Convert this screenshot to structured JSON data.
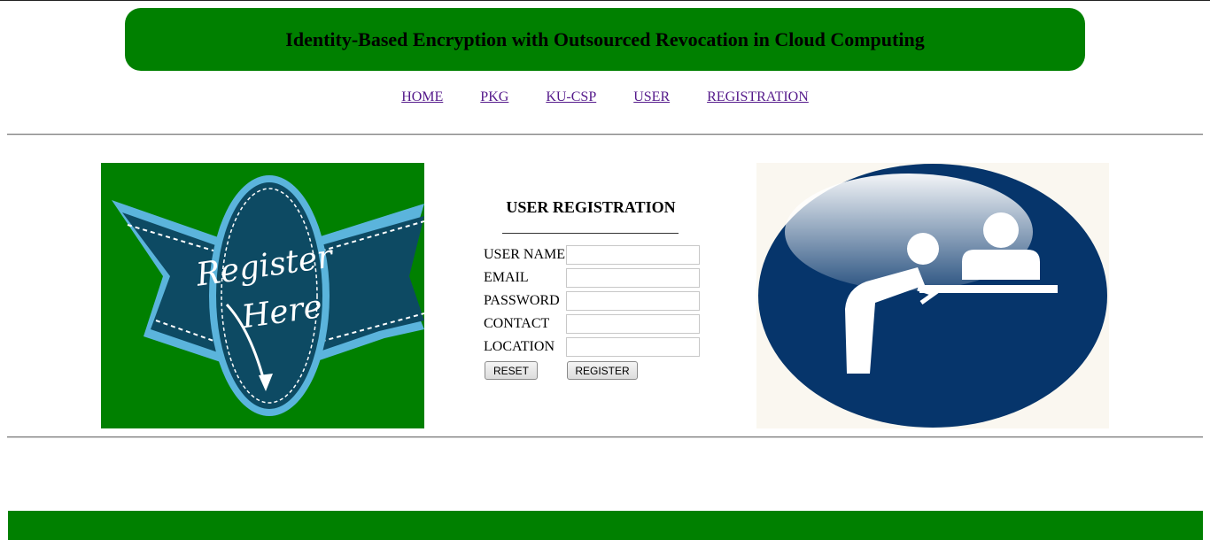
{
  "header": {
    "title": "Identity-Based Encryption with Outsourced Revocation in Cloud Computing"
  },
  "nav": {
    "items": [
      {
        "label": "HOME"
      },
      {
        "label": "PKG"
      },
      {
        "label": "KU-CSP"
      },
      {
        "label": "USER"
      },
      {
        "label": "REGISTRATION"
      }
    ]
  },
  "banner_image": {
    "text_line1": "Register",
    "text_line2": "Here"
  },
  "form": {
    "title": "USER REGISTRATION",
    "fields": [
      {
        "label": "USER NAME",
        "value": ""
      },
      {
        "label": "EMAIL",
        "value": ""
      },
      {
        "label": "PASSWORD",
        "value": ""
      },
      {
        "label": "CONTACT",
        "value": ""
      },
      {
        "label": "LOCATION",
        "value": ""
      }
    ],
    "reset_label": "RESET",
    "register_label": "REGISTER"
  },
  "colors": {
    "brand_green": "#008000",
    "link_visited": "#551a8b",
    "badge_dark": "#0d4a63",
    "badge_light": "#5bb4dc",
    "icon_navy": "#06356b"
  }
}
